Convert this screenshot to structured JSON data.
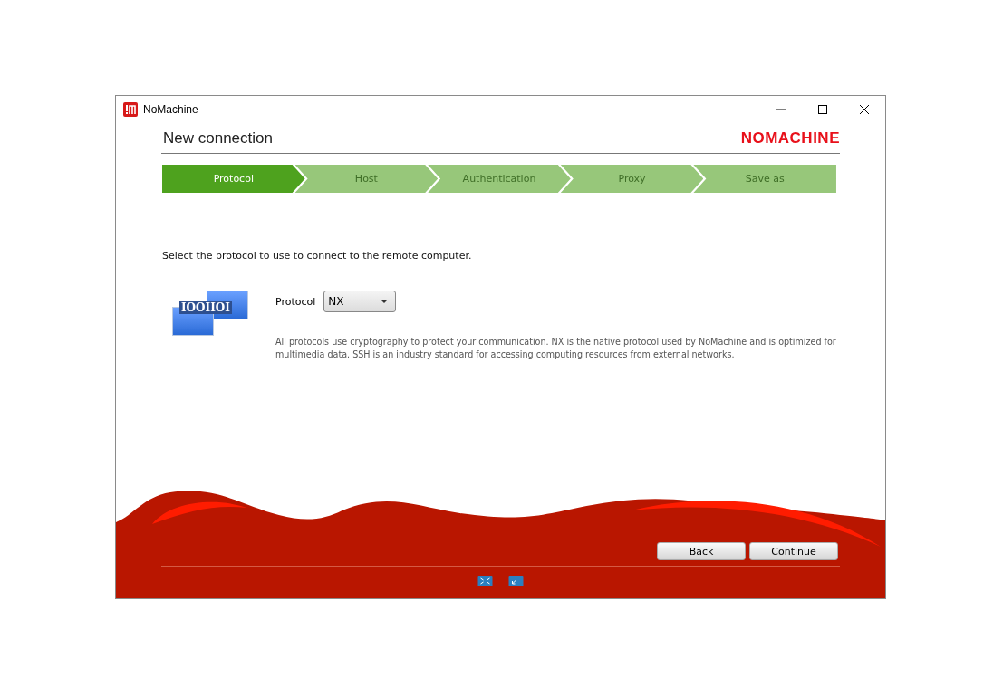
{
  "window": {
    "title": "NoMachine"
  },
  "header": {
    "title": "New connection",
    "logo": "NOMACHINE"
  },
  "steps": [
    {
      "label": "Protocol",
      "selected": true
    },
    {
      "label": "Host",
      "selected": false
    },
    {
      "label": "Authentication",
      "selected": false
    },
    {
      "label": "Proxy",
      "selected": false
    },
    {
      "label": "Save as",
      "selected": false
    }
  ],
  "instruction": "Select the protocol to use to connect to the remote computer.",
  "illustration_text": "IOOIIOI",
  "protocol": {
    "label": "Protocol",
    "value": "NX"
  },
  "description": "All protocols use cryptography to protect your communication. NX is the native protocol used by NoMachine and is optimized for multimedia data. SSH is an industry standard for accessing computing resources from external networks.",
  "buttons": [
    "Back",
    "Continue"
  ]
}
